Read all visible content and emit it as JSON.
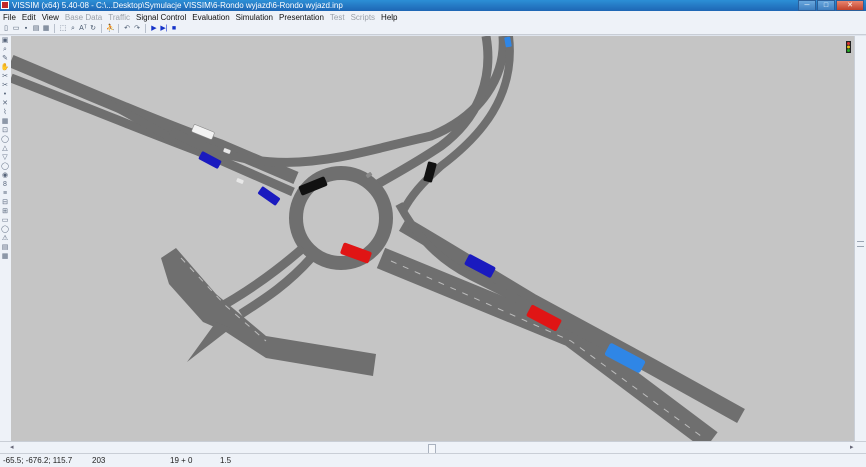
{
  "window": {
    "title": "VISSIM (x64) 5.40-08 - C:\\...Desktop\\Symulacje VISSIM\\6-Rondo wyjazd\\6-Rondo wyjazd.inp",
    "min_label": "─",
    "max_label": "□",
    "close_label": "✕"
  },
  "menu": {
    "items": [
      {
        "label": "File",
        "enabled": true
      },
      {
        "label": "Edit",
        "enabled": true
      },
      {
        "label": "View",
        "enabled": true
      },
      {
        "label": "Base Data",
        "enabled": false
      },
      {
        "label": "Traffic",
        "enabled": false
      },
      {
        "label": "Signal Control",
        "enabled": true
      },
      {
        "label": "Evaluation",
        "enabled": true
      },
      {
        "label": "Simulation",
        "enabled": true
      },
      {
        "label": "Presentation",
        "enabled": true
      },
      {
        "label": "Test",
        "enabled": false
      },
      {
        "label": "Scripts",
        "enabled": false
      },
      {
        "label": "Help",
        "enabled": true
      }
    ]
  },
  "toolbar": {
    "icons": [
      "new-file-icon",
      "open-file-icon",
      "save-icon",
      "print-preview-icon",
      "print-icon",
      "select-icon",
      "zoom-icon",
      "text-size-icon",
      "rotate-icon",
      "pedestrian-icon",
      "undo-icon",
      "redo-icon",
      "play-icon",
      "step-icon",
      "stop-icon"
    ],
    "glyphs": {
      "new": "▯",
      "open": "▭",
      "save": "▪",
      "preview": "▤",
      "print": "▦",
      "select": "⬚",
      "zoom": "⌕",
      "text": "Aᵀ",
      "rotate": "↻",
      "ped": "⛹",
      "undo": "↶",
      "redo": "↷",
      "play": "▶",
      "step": "▶|",
      "stop": "■"
    }
  },
  "left_tools": {
    "glyphs": [
      "▣",
      "⌕",
      "✎",
      "✋",
      "✂",
      "✂",
      "•",
      "✕",
      "⌇",
      "▦",
      "⊡",
      "◯",
      "△",
      "▽",
      "◯",
      "◉",
      "8",
      "≡",
      "⊟",
      "⊞",
      "▭",
      "◯",
      "⚠",
      "▤",
      "▦"
    ]
  },
  "statusbar": {
    "coordinates": "-65.5; -676.2; 115.7",
    "sim_time": "203",
    "vehicles": "19 + 0",
    "speed": "1.5"
  },
  "colors": {
    "canvas_bg": "#c5c5c5",
    "road": "#6f6f6f",
    "vehicle_blue": "#1a1abf",
    "vehicle_red": "#e01515",
    "vehicle_black": "#111111",
    "vehicle_white": "#f2f2f2",
    "vehicle_lightblue": "#2f86e6"
  }
}
